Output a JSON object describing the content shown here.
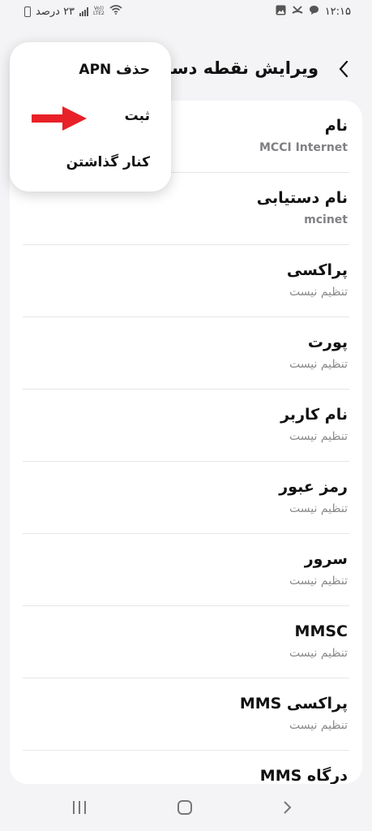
{
  "status_bar": {
    "battery_text": "۲۳ درصد",
    "time": "۱۲:۱۵",
    "network_label": "Vo))\nLTE2",
    "icons": [
      "battery-icon",
      "signal-icon",
      "volte-icon",
      "wifi-icon",
      "gallery-icon",
      "missed-call-icon",
      "message-icon"
    ]
  },
  "header": {
    "title": "ویرایش نقطه دست",
    "back_icon": "chevron-left-icon"
  },
  "fields": [
    {
      "title": "نام",
      "value": "MCCI Internet",
      "is_set": true
    },
    {
      "title": "نام دستیابی",
      "value": "mcinet",
      "is_set": true
    },
    {
      "title": "پراکسی",
      "value": "تنظیم نیست",
      "is_set": false
    },
    {
      "title": "پورت",
      "value": "تنظیم نیست",
      "is_set": false
    },
    {
      "title": "نام کاربر",
      "value": "تنظیم نیست",
      "is_set": false
    },
    {
      "title": "رمز عبور",
      "value": "تنظیم نیست",
      "is_set": false
    },
    {
      "title": "سرور",
      "value": "تنظیم نیست",
      "is_set": false
    },
    {
      "title": "MMSC",
      "value": "تنظیم نیست",
      "is_set": false
    },
    {
      "title": "پراکسی MMS",
      "value": "تنظیم نیست",
      "is_set": false
    },
    {
      "title": "درگاه MMS",
      "value": "",
      "is_set": false
    }
  ],
  "popup_menu": {
    "items": [
      {
        "label": "حذف APN"
      },
      {
        "label": "ثبت"
      },
      {
        "label": "کنار گذاشتن"
      }
    ],
    "highlight_arrow_color": "#e82027"
  },
  "nav_bar": {
    "icons": [
      "recents-icon",
      "home-icon",
      "back-icon"
    ]
  }
}
